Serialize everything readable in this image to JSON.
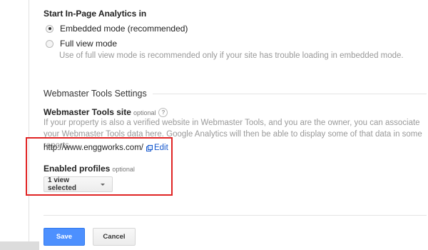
{
  "in_page_analytics": {
    "title": "Start In-Page Analytics in",
    "options": [
      {
        "label": "Embedded mode (recommended)",
        "selected": true
      },
      {
        "label": "Full view mode",
        "selected": false
      }
    ],
    "full_view_hint": "Use of full view mode is recommended only if your site has trouble loading in embedded mode."
  },
  "webmaster_tools": {
    "heading": "Webmaster Tools Settings",
    "site_label": "Webmaster Tools site",
    "site_optional": "optional",
    "help_icon_text": "?",
    "description": "If your property is also a verified website in Webmaster Tools, and you are the owner, you can associate your Webmaster Tools data here. Google Analytics will then be able to display some of that data in some reports.",
    "site_url": "http://www.enggworks.com/",
    "edit_label": "Edit"
  },
  "profiles": {
    "label": "Enabled profiles",
    "optional": "optional",
    "selected_value": "1 view selected"
  },
  "actions": {
    "save_label": "Save",
    "cancel_label": "Cancel"
  },
  "colors": {
    "accent": "#4d90fe",
    "link": "#1155cc",
    "highlight": "#e02424"
  }
}
